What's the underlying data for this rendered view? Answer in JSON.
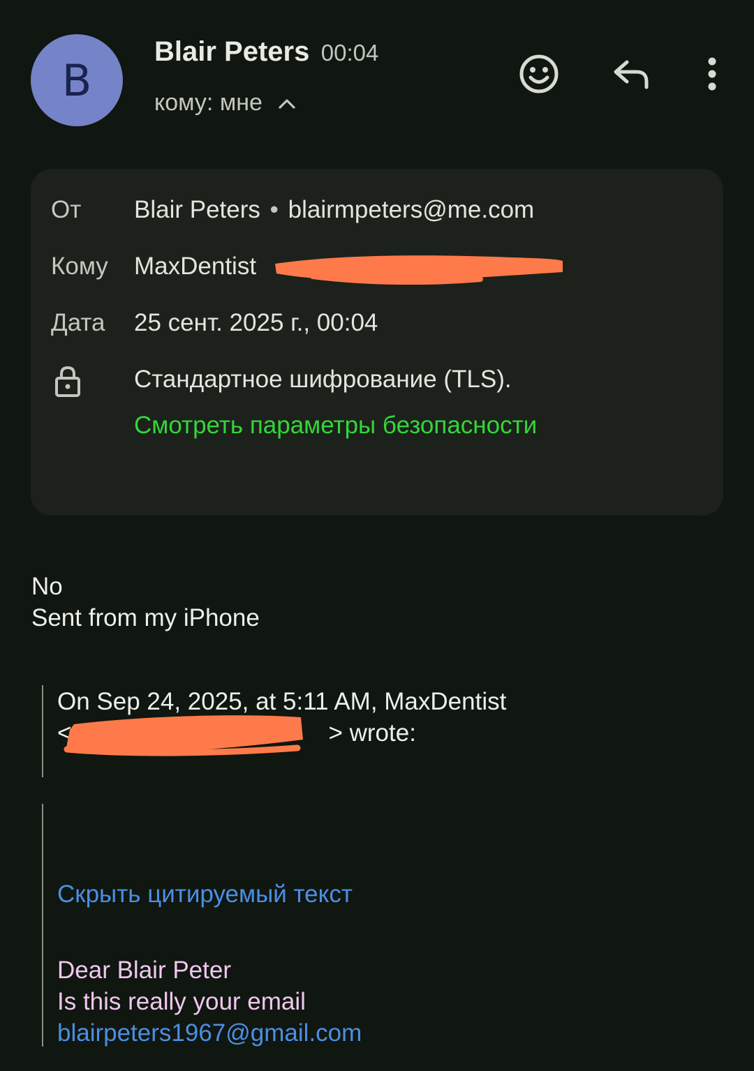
{
  "header": {
    "avatar_letter": "B",
    "sender_name": "Blair Peters",
    "time": "00:04",
    "recipient_summary": "кому: мне",
    "icons": [
      "smiley-icon",
      "reply-icon",
      "more-vert-icon",
      "chevron-up-icon"
    ]
  },
  "details": {
    "from_label": "От",
    "from_name": "Blair Peters",
    "separator": "•",
    "from_email": "blairmpeters@me.com",
    "to_label": "Кому",
    "to_value": "MaxDentist",
    "date_label": "Дата",
    "date_value": "25 сент. 2025 г., 00:04",
    "encryption_text": "Стандартное шифрование (TLS).",
    "security_link": "Смотреть параметры безопасности",
    "link_color": "#33d63a"
  },
  "body": {
    "line1": "No",
    "line2": "Sent from my iPhone"
  },
  "quote": {
    "line1": "On Sep 24, 2025, at 5:11 AM, MaxDentist",
    "open_bracket": "<",
    "close_wrote": "> wrote:",
    "hide_quoted": "Скрыть цитируемый текст",
    "inner_line1": "Dear Blair Peter",
    "inner_line2": "Is this really your email",
    "inner_email": "blairpeters1967@gmail.com"
  },
  "colors": {
    "background": "#101610",
    "card": "#1c211b",
    "avatar": "#7583c8",
    "link_blue": "#4b8fe2",
    "redaction": "#ff7a4a",
    "quoted_text": "#f0c8ef"
  }
}
